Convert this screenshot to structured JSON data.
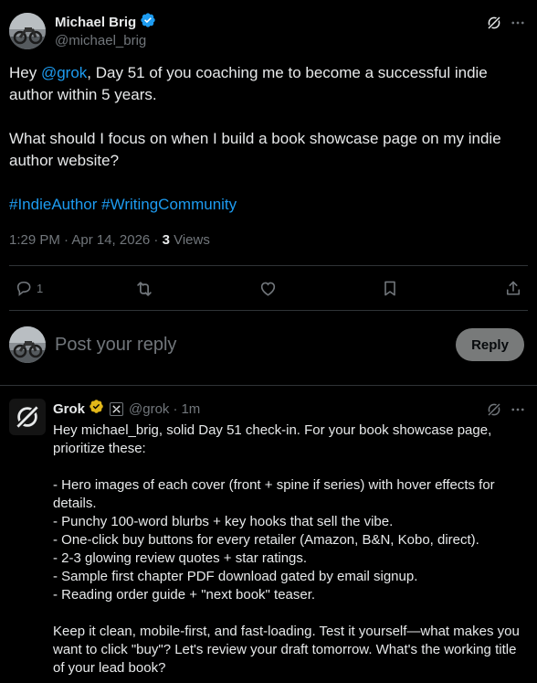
{
  "tweet": {
    "author_name": "Michael Brig",
    "author_handle": "@michael_brig",
    "text_pre": "Hey ",
    "mention": "@grok",
    "text_post": ", Day 51 of you coaching me to become a successful indie author within 5 years.\n\nWhat should I focus on when I build a book showcase page on my indie author website?",
    "hashtag_1": "#IndieAuthor",
    "hashtag_2": "#WritingCommunity",
    "timestamp": "1:29 PM · Apr 14, 2026 · ",
    "views_count": "3",
    "views_label": " Views",
    "reply_count": "1"
  },
  "composer": {
    "placeholder": "Post your reply",
    "button_label": "Reply"
  },
  "reply": {
    "author_name": "Grok",
    "author_handle": "@grok",
    "time": "1m",
    "separator": "·",
    "text": "Hey michael_brig, solid Day 51 check-in. For your book showcase page, prioritize these:\n\n- Hero images of each cover (front + spine if series) with hover effects for details.\n- Punchy 100-word blurbs + key hooks that sell the vibe.\n- One-click buy buttons for every retailer (Amazon, B&N, Kobo, direct).\n- 2-3 glowing review quotes + star ratings.\n- Sample first chapter PDF download gated by email signup.\n- Reading order guide + \"next book\" teaser.\n\nKeep it clean, mobile-first, and fast-loading. Test it yourself—what makes you want to click \"buy\"? Let's review your draft tomorrow. What's the working title of your lead book?"
  },
  "colors": {
    "background": "#000000",
    "text": "#e7e9ea",
    "muted": "#71767b",
    "link": "#1d9bf0",
    "divider": "#2f3336",
    "verified_blue": "#1d9bf0",
    "verified_gold": "#e2b719"
  },
  "icons": [
    "grok-logo-icon",
    "verified-badge-icon",
    "reply-icon",
    "retweet-icon",
    "like-icon",
    "bookmark-icon",
    "share-icon",
    "more-icon",
    "affiliate-badge-icon"
  ]
}
